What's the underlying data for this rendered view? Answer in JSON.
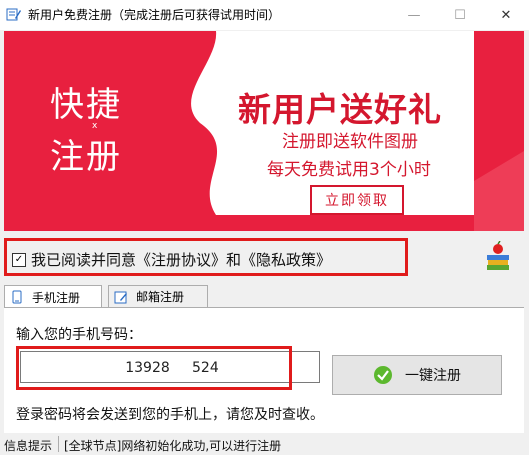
{
  "window": {
    "title": "新用户免费注册（完成注册后可获得试用时间）",
    "minimize": "—",
    "maximize": "☐",
    "close": "✕"
  },
  "banner": {
    "left_line1": "快捷",
    "left_line2": "注册",
    "left_mark": "x",
    "headline": "新用户送好礼",
    "sub1": "注册即送软件图册",
    "sub2": "每天免费试用3个小时",
    "claim_button": "立即领取",
    "colors": {
      "red": "#e8203f",
      "accent": "#d4172e",
      "white": "#ffffff"
    }
  },
  "agreement": {
    "checked": "✓",
    "text": "我已阅读并同意《注册协议》和《隐私政策》"
  },
  "tabs": [
    {
      "label": "手机注册",
      "icon": "phone-tab-icon"
    },
    {
      "label": "邮箱注册",
      "icon": "email-tab-icon"
    }
  ],
  "form": {
    "prompt": "输入您的手机号码：",
    "phone_value": "13928     524",
    "register_button": "一键注册",
    "notice": "登录密码将会发送到您的手机上，请您及时查收。"
  },
  "status": {
    "label": "信息提示",
    "message": "[全球节点]网络初始化成功,可以进行注册"
  }
}
